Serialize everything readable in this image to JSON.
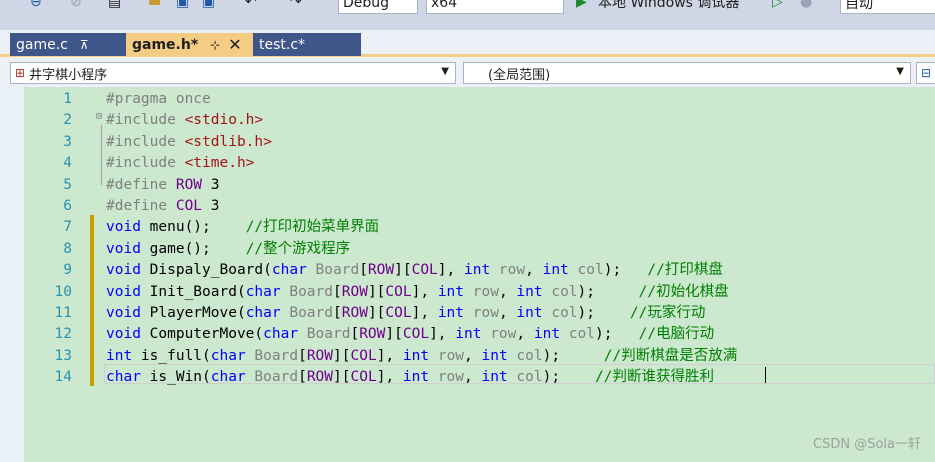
{
  "toolbar": {
    "config": "Debug",
    "platform": "x64",
    "run_label": "本地 Windows 调试器",
    "auto": "自动"
  },
  "tabs": [
    {
      "label": "game.c",
      "pin": "⊼"
    },
    {
      "label": "game.h*",
      "pin": "⊹",
      "close": "✕"
    },
    {
      "label": "test.c*"
    }
  ],
  "nav": {
    "project": "井字棋小程序",
    "scope": "(全局范围)"
  },
  "editor": {
    "lines": [
      {
        "n": "1",
        "t": [
          [
            "pp",
            "#pragma once"
          ]
        ]
      },
      {
        "n": "2",
        "t": [
          [
            "pp",
            "#include "
          ],
          [
            "str",
            "<stdio.h>"
          ]
        ]
      },
      {
        "n": "3",
        "t": [
          [
            "pp",
            "#include "
          ],
          [
            "str",
            "<stdlib.h>"
          ]
        ]
      },
      {
        "n": "4",
        "t": [
          [
            "pp",
            "#include "
          ],
          [
            "str",
            "<time.h>"
          ]
        ]
      },
      {
        "n": "5",
        "t": [
          [
            "pp",
            "#define "
          ],
          [
            "mac",
            "ROW"
          ],
          [
            "txt",
            " 3"
          ]
        ]
      },
      {
        "n": "6",
        "t": [
          [
            "pp",
            "#define "
          ],
          [
            "mac",
            "COL"
          ],
          [
            "txt",
            " 3"
          ]
        ]
      },
      {
        "n": "7",
        "t": [
          [
            "kw",
            "void"
          ],
          [
            "txt",
            " menu();    "
          ],
          [
            "cm",
            "//打印初始菜单界面"
          ]
        ]
      },
      {
        "n": "8",
        "t": [
          [
            "kw",
            "void"
          ],
          [
            "txt",
            " game();    "
          ],
          [
            "cm",
            "//整个游戏程序"
          ]
        ]
      },
      {
        "n": "9",
        "t": [
          [
            "kw",
            "void"
          ],
          [
            "txt",
            " Dispaly_Board("
          ],
          [
            "kw",
            "char"
          ],
          [
            "prm",
            " Board"
          ],
          [
            "txt",
            "["
          ],
          [
            "mac",
            "ROW"
          ],
          [
            "txt",
            "]["
          ],
          [
            "mac",
            "COL"
          ],
          [
            "txt",
            "], "
          ],
          [
            "kw",
            "int"
          ],
          [
            "prm",
            " row"
          ],
          [
            "txt",
            ", "
          ],
          [
            "kw",
            "int"
          ],
          [
            "prm",
            " col"
          ],
          [
            "txt",
            ");   "
          ],
          [
            "cm",
            "//打印棋盘"
          ]
        ]
      },
      {
        "n": "10",
        "t": [
          [
            "kw",
            "void"
          ],
          [
            "txt",
            " Init_Board("
          ],
          [
            "kw",
            "char"
          ],
          [
            "prm",
            " Board"
          ],
          [
            "txt",
            "["
          ],
          [
            "mac",
            "ROW"
          ],
          [
            "txt",
            "]["
          ],
          [
            "mac",
            "COL"
          ],
          [
            "txt",
            "], "
          ],
          [
            "kw",
            "int"
          ],
          [
            "prm",
            " row"
          ],
          [
            "txt",
            ", "
          ],
          [
            "kw",
            "int"
          ],
          [
            "prm",
            " col"
          ],
          [
            "txt",
            ");     "
          ],
          [
            "cm",
            "//初始化棋盘"
          ]
        ]
      },
      {
        "n": "11",
        "t": [
          [
            "kw",
            "void"
          ],
          [
            "txt",
            " PlayerMove("
          ],
          [
            "kw",
            "char"
          ],
          [
            "prm",
            " Board"
          ],
          [
            "txt",
            "["
          ],
          [
            "mac",
            "ROW"
          ],
          [
            "txt",
            "]["
          ],
          [
            "mac",
            "COL"
          ],
          [
            "txt",
            "], "
          ],
          [
            "kw",
            "int"
          ],
          [
            "prm",
            " row"
          ],
          [
            "txt",
            ", "
          ],
          [
            "kw",
            "int"
          ],
          [
            "prm",
            " col"
          ],
          [
            "txt",
            ");    "
          ],
          [
            "cm",
            "//玩家行动"
          ]
        ]
      },
      {
        "n": "12",
        "t": [
          [
            "kw",
            "void"
          ],
          [
            "txt",
            " ComputerMove("
          ],
          [
            "kw",
            "char"
          ],
          [
            "prm",
            " Board"
          ],
          [
            "txt",
            "["
          ],
          [
            "mac",
            "ROW"
          ],
          [
            "txt",
            "]["
          ],
          [
            "mac",
            "COL"
          ],
          [
            "txt",
            "], "
          ],
          [
            "kw",
            "int"
          ],
          [
            "prm",
            " row"
          ],
          [
            "txt",
            ", "
          ],
          [
            "kw",
            "int"
          ],
          [
            "prm",
            " col"
          ],
          [
            "txt",
            ");   "
          ],
          [
            "cm",
            "//电脑行动"
          ]
        ]
      },
      {
        "n": "13",
        "t": [
          [
            "kw",
            "int"
          ],
          [
            "txt",
            " is_full("
          ],
          [
            "kw",
            "char"
          ],
          [
            "prm",
            " Board"
          ],
          [
            "txt",
            "["
          ],
          [
            "mac",
            "ROW"
          ],
          [
            "txt",
            "]["
          ],
          [
            "mac",
            "COL"
          ],
          [
            "txt",
            "], "
          ],
          [
            "kw",
            "int"
          ],
          [
            "prm",
            " row"
          ],
          [
            "txt",
            ", "
          ],
          [
            "kw",
            "int"
          ],
          [
            "prm",
            " col"
          ],
          [
            "txt",
            ");     "
          ],
          [
            "cm",
            "//判断棋盘是否放满"
          ]
        ]
      },
      {
        "n": "14",
        "t": [
          [
            "kw",
            "char"
          ],
          [
            "txt",
            " is_Win("
          ],
          [
            "kw",
            "char"
          ],
          [
            "prm",
            " Board"
          ],
          [
            "txt",
            "["
          ],
          [
            "mac",
            "ROW"
          ],
          [
            "txt",
            "]["
          ],
          [
            "mac",
            "COL"
          ],
          [
            "txt",
            "], "
          ],
          [
            "kw",
            "int"
          ],
          [
            "prm",
            " row"
          ],
          [
            "txt",
            ", "
          ],
          [
            "kw",
            "int"
          ],
          [
            "prm",
            " col"
          ],
          [
            "txt",
            ");    "
          ],
          [
            "cm",
            "//判断谁获得胜利"
          ]
        ]
      }
    ]
  },
  "watermark": "CSDN @Sola一轩"
}
